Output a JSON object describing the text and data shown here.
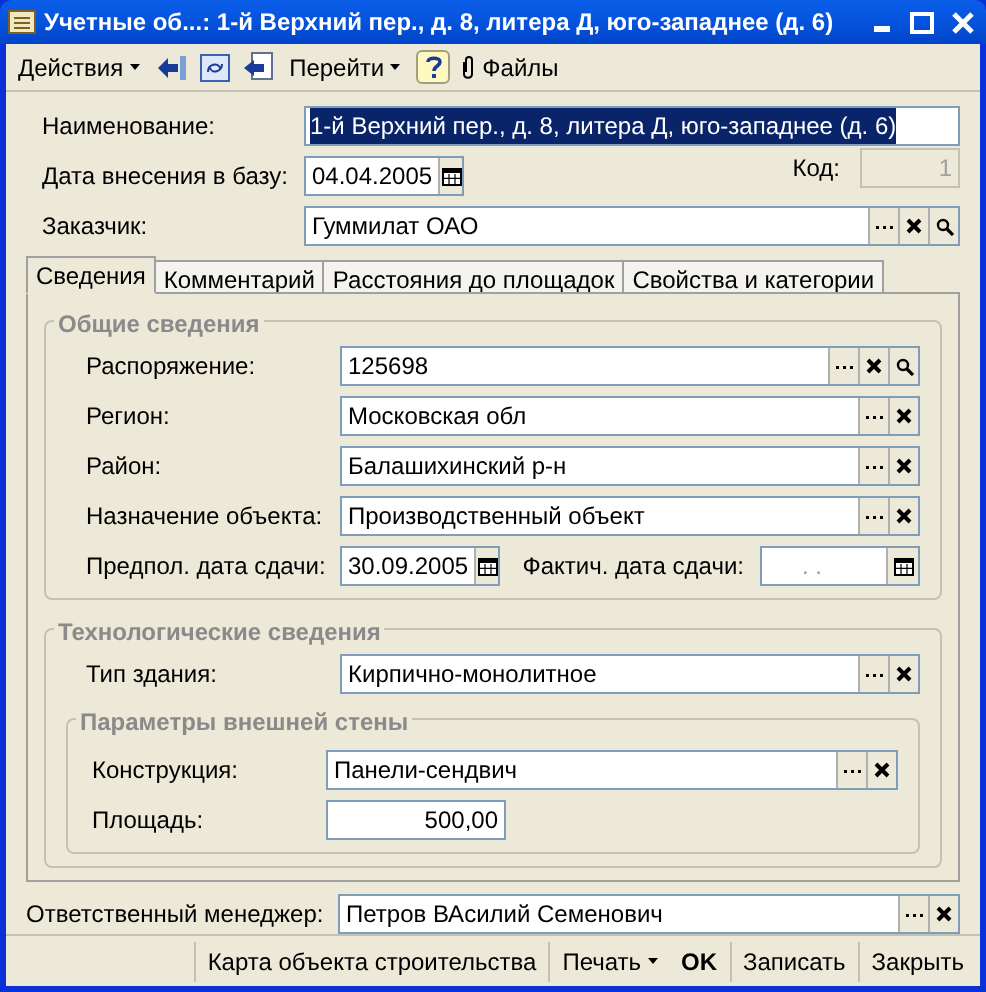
{
  "window": {
    "title": "Учетные об...: 1-й Верхний пер., д. 8, литера Д, юго-западнее (д. 6)"
  },
  "toolbar": [
    {
      "kind": "menu",
      "label": "Действия"
    },
    {
      "kind": "icon"
    },
    {
      "kind": "icon"
    },
    {
      "kind": "icon"
    },
    {
      "kind": "menu",
      "label": "Перейти"
    },
    {
      "kind": "icon"
    },
    {
      "kind": "attach",
      "label": "Файлы"
    }
  ],
  "header": {
    "name": {
      "label": "Наименование:",
      "value": "1-й Верхний пер., д. 8, литера Д, юго-западнее (д. 6)",
      "text_selected": true
    },
    "date": {
      "label": "Дата внесения в базу:",
      "value": "04.04.2005"
    },
    "code": {
      "label": "Код:",
      "value": "1",
      "disabled": true
    },
    "customer": {
      "label": "Заказчик:",
      "value": "Гуммилат ОАО",
      "search_button": true
    }
  },
  "tabs": [
    {
      "label": "Сведения",
      "selected": true
    },
    {
      "label": "Комментарий",
      "selected": false
    },
    {
      "label": "Расстояния до площадок",
      "selected": false
    },
    {
      "label": "Свойства и категории",
      "selected": false
    }
  ],
  "general": {
    "title": "Общие сведения",
    "fields": [
      {
        "label": "Распоряжение:",
        "value": "125698",
        "search_button": true
      },
      {
        "label": "Регион:",
        "value": "Московская обл",
        "search_button": false
      },
      {
        "label": "Район:",
        "value": "Балашихинский р-н",
        "search_button": false
      },
      {
        "label": "Назначение объекта:",
        "value": "Производственный объект",
        "search_button": false
      }
    ],
    "planned_date": {
      "label": "Предпол. дата сдачи:",
      "value": "30.09.2005"
    },
    "actual_date": {
      "label": "Фактич. дата сдачи:",
      "placeholder": ". ."
    }
  },
  "tech": {
    "title": "Технологические сведения",
    "building_type": {
      "label": "Тип здания:",
      "value": "Кирпично-монолитное",
      "search_button": false
    },
    "wall": {
      "title": "Параметры внешней стены",
      "construction": {
        "label": "Конструкция:",
        "value": "Панели-сендвич",
        "search_button": false
      },
      "area": {
        "label": "Площадь:",
        "value": "500,00"
      }
    }
  },
  "manager": {
    "label": "Ответственный менеджер:",
    "value": "Петров ВАсилий Семенович",
    "search_button": false
  },
  "footer": [
    {
      "kind": "button",
      "label": "Карта объекта строительства"
    },
    {
      "kind": "menu",
      "label": "Печать"
    },
    {
      "kind": "bold",
      "label": "OK"
    },
    {
      "kind": "button",
      "label": "Записать"
    },
    {
      "kind": "button",
      "label": "Закрыть"
    }
  ]
}
